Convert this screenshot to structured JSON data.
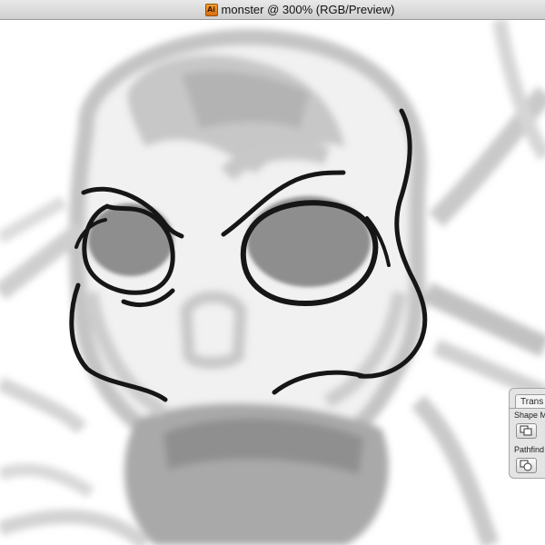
{
  "window": {
    "title": "monster @ 300% (RGB/Preview)",
    "doc_icon": "illustrator-doc-icon",
    "doc_icon_glyph": "Ai"
  },
  "panel": {
    "tab_label": "Trans",
    "shape_modes_label": "Shape M",
    "pathfinders_label": "Pathfind",
    "shape_mode_icon": "unite-icon",
    "pathfinder_icon": "divide-icon"
  },
  "colors": {
    "stroke": "#161616",
    "sketch_dark": "#9a9a9a",
    "sketch_mid": "#bdbdbd",
    "sketch_light": "#d7d7d7"
  }
}
